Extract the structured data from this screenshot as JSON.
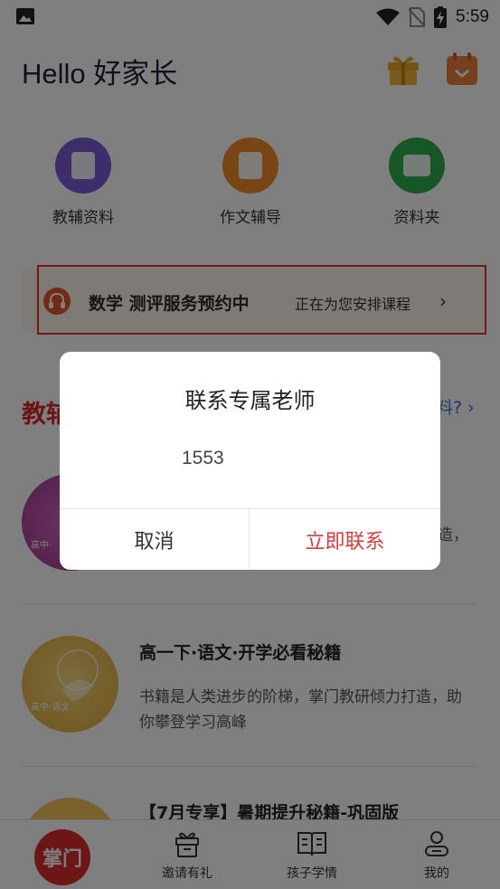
{
  "status_bar": {
    "time": "5:59"
  },
  "header": {
    "title": "Hello 好家长"
  },
  "quick_entries": [
    {
      "label": "教辅资料",
      "color": "#7a5bd6"
    },
    {
      "label": "作文辅导",
      "color": "#f08a2a"
    },
    {
      "label": "资料夹",
      "color": "#2fae4a"
    }
  ],
  "banner": {
    "title": "数学 测评服务预约中",
    "subtitle": "正在为您安排课程",
    "chevron": "›"
  },
  "section": {
    "title_partial": "教辅",
    "link_partial": "料?",
    "link_chevron": "›"
  },
  "list": [
    {
      "title": "",
      "desc_partial": "造，",
      "thumb_tag": "高中·"
    },
    {
      "title": "高一下·语文·开学必看秘籍",
      "desc": "书籍是人类进步的阶梯，掌门教研倾力打造，助你攀登学习高峰",
      "thumb_tag": "高中·语文"
    },
    {
      "title": "【7月专享】暑期提升秘籍-巩固版"
    }
  ],
  "bottom_nav": {
    "logo": "掌门",
    "items": [
      {
        "label": "邀请有礼"
      },
      {
        "label": "孩子学情"
      },
      {
        "label": "我的"
      }
    ]
  },
  "dialog": {
    "title": "联系专属老师",
    "phone": "1553",
    "cancel_label": "取消",
    "contact_label": "立即联系"
  },
  "colors": {
    "accent_red": "#e03a3a",
    "banner_bg": "#fdf4ea",
    "section_red": "#d8262b",
    "link_blue": "#2d6cdf"
  }
}
